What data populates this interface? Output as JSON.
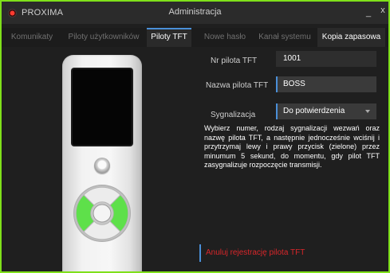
{
  "app": {
    "logo_text": "PROXIMA",
    "window_title": "Administracja",
    "minimize_label": "_",
    "close_label": "x",
    "accent_color": "#4a8fd8",
    "frame_color": "#7fe01a"
  },
  "tabs": [
    {
      "label": "Komunikaty"
    },
    {
      "label": "Piloty użytkowników"
    },
    {
      "label": "Piloty TFT"
    },
    {
      "label": "Nowe hasło"
    },
    {
      "label": "Kanał systemu"
    },
    {
      "label": "Kopia zapasowa"
    }
  ],
  "form": {
    "number_label": "Nr pilota TFT",
    "number_value": "1001",
    "name_label": "Nazwa pilota TFT",
    "name_value": "BOSS",
    "signal_label": "Sygnalizacja",
    "signal_value": "Do potwierdzenia",
    "instructions": "Wybierz numer, rodzaj sygnalizacji wezwań oraz nazwę pilota TFT, a następnie jednocześnie wciśnij i przytrzymaj lewy i prawy przycisk (zielone) przez minumum 5 sekund, do momentu, gdy pilot TFT zasygnalizuje rozpoczęcie transmisji.",
    "cancel_label": "Anuluj rejestrację pilota TFT"
  },
  "remote": {
    "highlight_color": "#5ee04a",
    "highlighted_buttons": [
      "left",
      "right"
    ]
  }
}
